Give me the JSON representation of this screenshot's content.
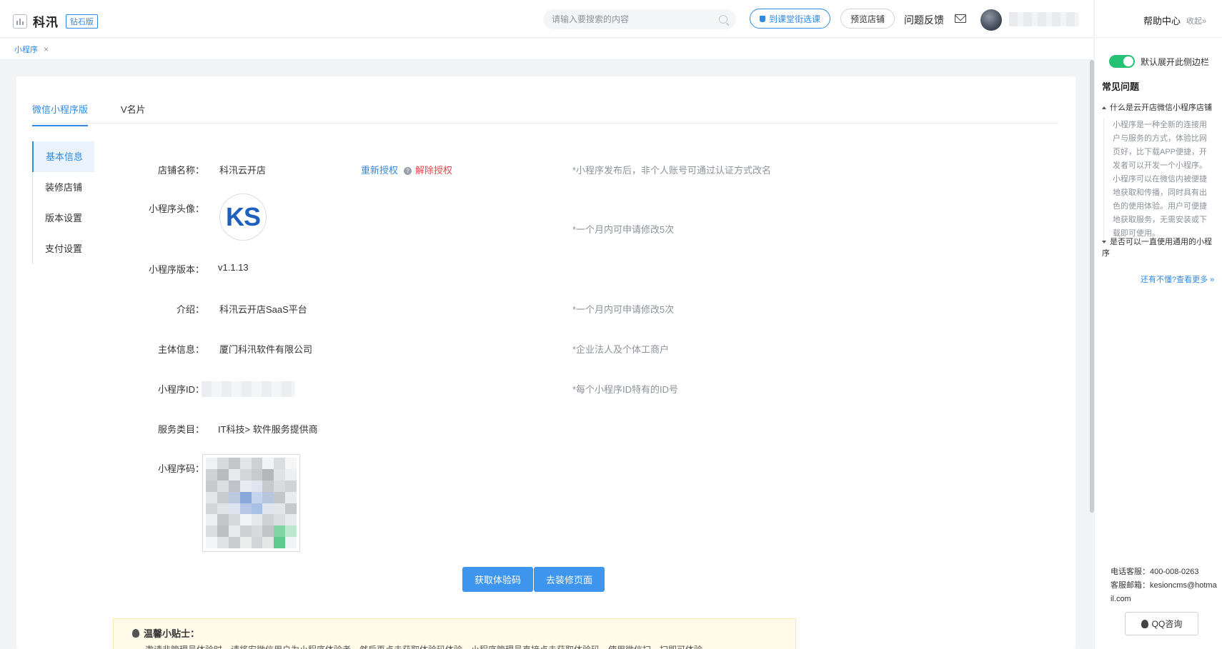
{
  "header": {
    "brand_name": "科汛",
    "edition_badge": "钻石版",
    "search_placeholder": "请输入要搜索的内容",
    "class_button": "到课堂街选课",
    "preview_button": "预览店铺",
    "feedback": "问题反馈"
  },
  "page_tab": {
    "label": "小程序",
    "close": "×"
  },
  "top_tabs": [
    "微信小程序版",
    "V名片"
  ],
  "side_menu": [
    "基本信息",
    "装修店铺",
    "版本设置",
    "支付设置"
  ],
  "form": {
    "shop_name": {
      "label": "店铺名称：",
      "value": "科汛云开店",
      "reauth": "重新授权",
      "help": "?",
      "unauth": "解除授权",
      "hint": "*小程序发布后，非个人账号可通过认证方式改名"
    },
    "avatar": {
      "label": "小程序头像：",
      "logo_text": "KS",
      "hint": "*一个月内可申请修改5次"
    },
    "version": {
      "label": "小程序版本：",
      "value": "v1.1.13"
    },
    "intro": {
      "label": "介绍：",
      "value": "科汛云开店SaaS平台",
      "hint": "*一个月内可申请修改5次"
    },
    "entity": {
      "label": "主体信息：",
      "value": "厦门科汛软件有限公司",
      "hint": "*企业法人及个体工商户"
    },
    "app_id": {
      "label": "小程序ID：",
      "hint": "*每个小程序ID特有的ID号"
    },
    "category": {
      "label": "服务类目：",
      "value": "IT科技> 软件服务提供商"
    },
    "qrcode": {
      "label": "小程序码："
    }
  },
  "actions": {
    "get_code": "获取体验码",
    "decorate": "去装修页面"
  },
  "tip": {
    "title": "温馨小贴士：",
    "text": "邀请非管理员体验时，请将安微信用户为小程序体验者，然后再点击获取体验码体验。小程序管理员直接点击获取体验码，使用微信扫一扫即可体验"
  },
  "help_panel": {
    "title": "帮助中心",
    "collapse": "收起»",
    "toggle_label": "默认展开此侧边栏",
    "faq_title": "常见问题",
    "q1": "什么是云开店微信小程序店铺",
    "a1": "小程序是一种全新的连接用户与服务的方式，体验比网页好，比下载APP便捷，开发者可以开发一个小程序。小程序可以在微信内被便捷地获取和传播，同时具有出色的使用体验。用户可便捷地获取服务，无需安装或下载即可使用。",
    "q2": "是否可以一直使用通用的小程序",
    "more": "还有不懂?查看更多 »",
    "phone": "电话客服：400-008-0263",
    "email": "客服邮箱：kesioncms@hotmail.com",
    "qq": "QQ咨询"
  },
  "colors": {
    "accent": "#2f8ae5",
    "danger": "#e8484b",
    "toggle_on": "#25c275"
  }
}
